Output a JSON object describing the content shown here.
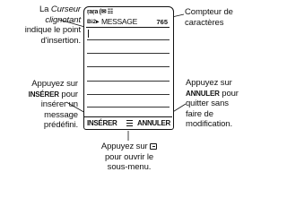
{
  "phone": {
    "status": "ṛaṛa (✉ ☷",
    "header_left": "Bi2▸",
    "title": "MESSAGE",
    "counter": "765",
    "softkey_left": "INSÉRER",
    "softkey_menu_icon": "menu-lines-icon",
    "softkey_right": "ANNULER"
  },
  "annotations": {
    "cursor": {
      "line1_pre": "La ",
      "line1_it": "Curseur",
      "line2_it": "clignotant",
      "line3": "indique le point",
      "line4": "d'insertion."
    },
    "counter": {
      "line1": "Compteur de",
      "line2": "caractères"
    },
    "insert": {
      "line1": "Appuyez sur",
      "line2_key": "INSÉRER",
      "line2_rest": " pour",
      "line3": "insérer un",
      "line4": "message",
      "line5": "prédéfini."
    },
    "cancel": {
      "line1": "Appuyez sur",
      "line2_key": "ANNULER",
      "line2_rest": " pour",
      "line3": "quitter sans",
      "line4": "faire de",
      "line5": "modification."
    },
    "menu": {
      "line1": "Appuyez sur",
      "line2": "pour ouvrir le",
      "line3": "sous-menu."
    }
  }
}
